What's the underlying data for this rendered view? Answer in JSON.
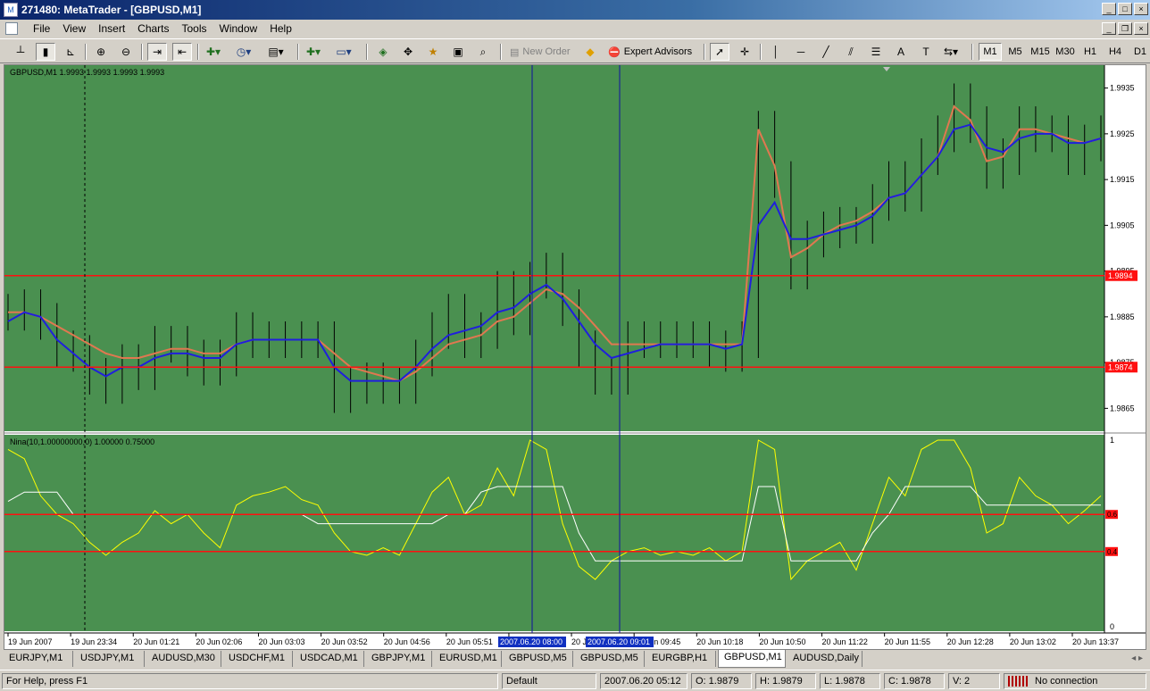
{
  "window": {
    "title": "271480: MetaTrader - [GBPUSD,M1]"
  },
  "menu": [
    "File",
    "View",
    "Insert",
    "Charts",
    "Tools",
    "Window",
    "Help"
  ],
  "toolbar": {
    "new_order": "New Order",
    "expert_advisors": "Expert Advisors",
    "text_tool": "A",
    "timeframes": [
      "M1",
      "M5",
      "M15",
      "M30",
      "H1",
      "H4",
      "D1"
    ],
    "active_timeframe": "M1"
  },
  "main_chart": {
    "header": "GBPUSD,M1  1.9993 1.9993 1.9993 1.9993",
    "price_labels": [
      "1.9935",
      "1.9925",
      "1.9915",
      "1.9905",
      "1.9895",
      "1.9885",
      "1.9875",
      "1.9865"
    ],
    "hlines": [
      {
        "label": "1.9894",
        "value": 1.9894
      },
      {
        "label": "1.9874",
        "value": 1.9874
      }
    ]
  },
  "indicator": {
    "header": "Nina(10,1.00000000,0) 1.00000 0.75000",
    "scale_labels": [
      "1",
      "0"
    ],
    "levels": [
      {
        "label": "0.6",
        "value": 0.6
      },
      {
        "label": "0.4",
        "value": 0.4
      }
    ]
  },
  "time_axis": {
    "labels": [
      "19 Jun 2007",
      "19 Jun 23:34",
      "20 Jun 01:21",
      "20 Jun 02:06",
      "20 Jun 03:03",
      "20 Jun 03:52",
      "20 Jun 04:56",
      "20 Jun 05:51",
      "20 Jun 0",
      "20 Jun 09:12",
      "20 Jun 09:45",
      "20 Jun 10:18",
      "20 Jun 10:50",
      "20 Jun 11:22",
      "20 Jun 11:55",
      "20 Jun 12:28",
      "20 Jun 13:02",
      "20 Jun 13:37"
    ],
    "markers": [
      "2007.06.20 08:00",
      "2007.06.20 09:01"
    ]
  },
  "chart_data": [
    {
      "type": "line",
      "title": "GBPUSD,M1",
      "series": [
        {
          "name": "",
          "color": "#000000",
          "values": [
            1.9886,
            1.9887,
            1.9884,
            1.9878,
            1.9877,
            1.9872,
            1.987,
            1.9875,
            1.9873,
            1.9879,
            1.9879,
            1.9876,
            1.9874,
            1.9876,
            1.9882,
            1.988,
            1.988,
            1.988,
            1.988,
            1.988,
            1.9868,
            1.987,
            1.9871,
            1.987,
            1.987,
            1.9876,
            1.9882,
            1.9886,
            1.988,
            1.9882,
            1.9891,
            1.9885,
            1.9893,
            1.9895,
            1.9887,
            1.9878,
            1.9872,
            1.9872,
            1.988,
            1.988,
            1.988,
            1.988,
            1.988,
            1.9878,
            1.9877,
            1.988,
            1.9926,
            1.9915,
            1.9895,
            1.9902,
            1.9904,
            1.9905,
            1.9905,
            1.991,
            1.9915,
            1.9912,
            1.992,
            1.9925,
            1.9932,
            1.9927,
            1.9917,
            1.992,
            1.9927,
            1.9925,
            1.9925,
            1.992,
            1.9923,
            1.9925
          ]
        },
        {
          "name": "",
          "color": "#1f1fdc",
          "values": [
            1.9884,
            1.9886,
            1.9885,
            1.988,
            1.9877,
            1.9874,
            1.9872,
            1.9874,
            1.9874,
            1.9876,
            1.9877,
            1.9877,
            1.9876,
            1.9876,
            1.9879,
            1.988,
            1.988,
            1.988,
            1.988,
            1.988,
            1.9874,
            1.9871,
            1.9871,
            1.9871,
            1.9871,
            1.9874,
            1.9878,
            1.9881,
            1.9882,
            1.9883,
            1.9886,
            1.9887,
            1.989,
            1.9892,
            1.9889,
            1.9884,
            1.9879,
            1.9876,
            1.9877,
            1.9878,
            1.9879,
            1.9879,
            1.9879,
            1.9879,
            1.9878,
            1.9879,
            1.9905,
            1.991,
            1.9902,
            1.9902,
            1.9903,
            1.9904,
            1.9905,
            1.9907,
            1.9911,
            1.9912,
            1.9916,
            1.992,
            1.9926,
            1.9927,
            1.9922,
            1.9921,
            1.9924,
            1.9925,
            1.9925,
            1.9923,
            1.9923,
            1.9924
          ]
        },
        {
          "name": "",
          "color": "#e07850",
          "values": [
            1.9886,
            1.9886,
            1.9885,
            1.9883,
            1.9881,
            1.9879,
            1.9877,
            1.9876,
            1.9876,
            1.9877,
            1.9878,
            1.9878,
            1.9877,
            1.9877,
            1.9879,
            1.988,
            1.988,
            1.988,
            1.988,
            1.988,
            1.9877,
            1.9874,
            1.9873,
            1.9872,
            1.9871,
            1.9873,
            1.9876,
            1.9879,
            1.988,
            1.9881,
            1.9884,
            1.9885,
            1.9888,
            1.9891,
            1.989,
            1.9887,
            1.9883,
            1.9879,
            1.9879,
            1.9879,
            1.9879,
            1.9879,
            1.9879,
            1.9879,
            1.9879,
            1.9879,
            1.9926,
            1.9918,
            1.9898,
            1.99,
            1.9903,
            1.9905,
            1.9906,
            1.9908,
            1.9911,
            1.9912,
            1.9916,
            1.992,
            1.9931,
            1.9928,
            1.9919,
            1.992,
            1.9926,
            1.9926,
            1.9925,
            1.9924,
            1.9923,
            1.9924
          ]
        }
      ],
      "ylim": [
        1.986,
        1.994
      ]
    },
    {
      "type": "line",
      "title": "Nina(10,1.00000000,0)",
      "series": [
        {
          "name": "",
          "color": "#ffff00",
          "values": [
            0.95,
            0.9,
            0.7,
            0.6,
            0.55,
            0.45,
            0.38,
            0.45,
            0.5,
            0.62,
            0.55,
            0.6,
            0.5,
            0.42,
            0.65,
            0.7,
            0.72,
            0.75,
            0.68,
            0.65,
            0.5,
            0.4,
            0.38,
            0.42,
            0.38,
            0.55,
            0.72,
            0.8,
            0.6,
            0.65,
            0.85,
            0.7,
            1.0,
            0.95,
            0.55,
            0.32,
            0.25,
            0.35,
            0.4,
            0.42,
            0.38,
            0.4,
            0.38,
            0.42,
            0.35,
            0.4,
            1.0,
            0.95,
            0.25,
            0.35,
            0.4,
            0.45,
            0.3,
            0.55,
            0.8,
            0.7,
            0.95,
            1.0,
            1.0,
            0.85,
            0.5,
            0.55,
            0.8,
            0.7,
            0.65,
            0.55,
            0.62,
            0.7
          ]
        },
        {
          "name": "",
          "color": "#ffffff",
          "values": [
            0.67,
            0.72,
            0.72,
            0.72,
            0.6,
            0.6,
            0.6,
            0.6,
            0.6,
            0.6,
            0.6,
            0.6,
            0.6,
            0.6,
            0.6,
            0.6,
            0.6,
            0.6,
            0.6,
            0.55,
            0.55,
            0.55,
            0.55,
            0.55,
            0.55,
            0.55,
            0.55,
            0.6,
            0.6,
            0.72,
            0.75,
            0.75,
            0.75,
            0.75,
            0.75,
            0.5,
            0.35,
            0.35,
            0.35,
            0.35,
            0.35,
            0.35,
            0.35,
            0.35,
            0.35,
            0.35,
            0.75,
            0.75,
            0.35,
            0.35,
            0.35,
            0.35,
            0.35,
            0.5,
            0.6,
            0.75,
            0.75,
            0.75,
            0.75,
            0.75,
            0.65,
            0.65,
            0.65,
            0.65,
            0.65,
            0.65,
            0.65,
            0.65
          ]
        }
      ],
      "ylim": [
        0,
        1
      ]
    }
  ],
  "tabs": [
    "EURJPY,M1",
    "USDJPY,M1",
    "AUDUSD,M30",
    "USDCHF,M1",
    "USDCAD,M1",
    "GBPJPY,M1",
    "EURUSD,M1",
    "GBPUSD,M5",
    "GBPUSD,M5",
    "EURGBP,H1",
    "GBPUSD,M1",
    "AUDUSD,Daily"
  ],
  "active_tab": "GBPUSD,M1",
  "status": {
    "help": "For Help, press F1",
    "profile": "Default",
    "datetime": "2007.06.20 05:12",
    "open": "O: 1.9879",
    "high": "H: 1.9879",
    "low": "L: 1.9878",
    "close": "C: 1.9878",
    "volume": "V: 2",
    "connection": "No connection"
  },
  "colors": {
    "chart_bg": "#4a9050",
    "level": "#ff1010",
    "vline": "#1010a0"
  }
}
